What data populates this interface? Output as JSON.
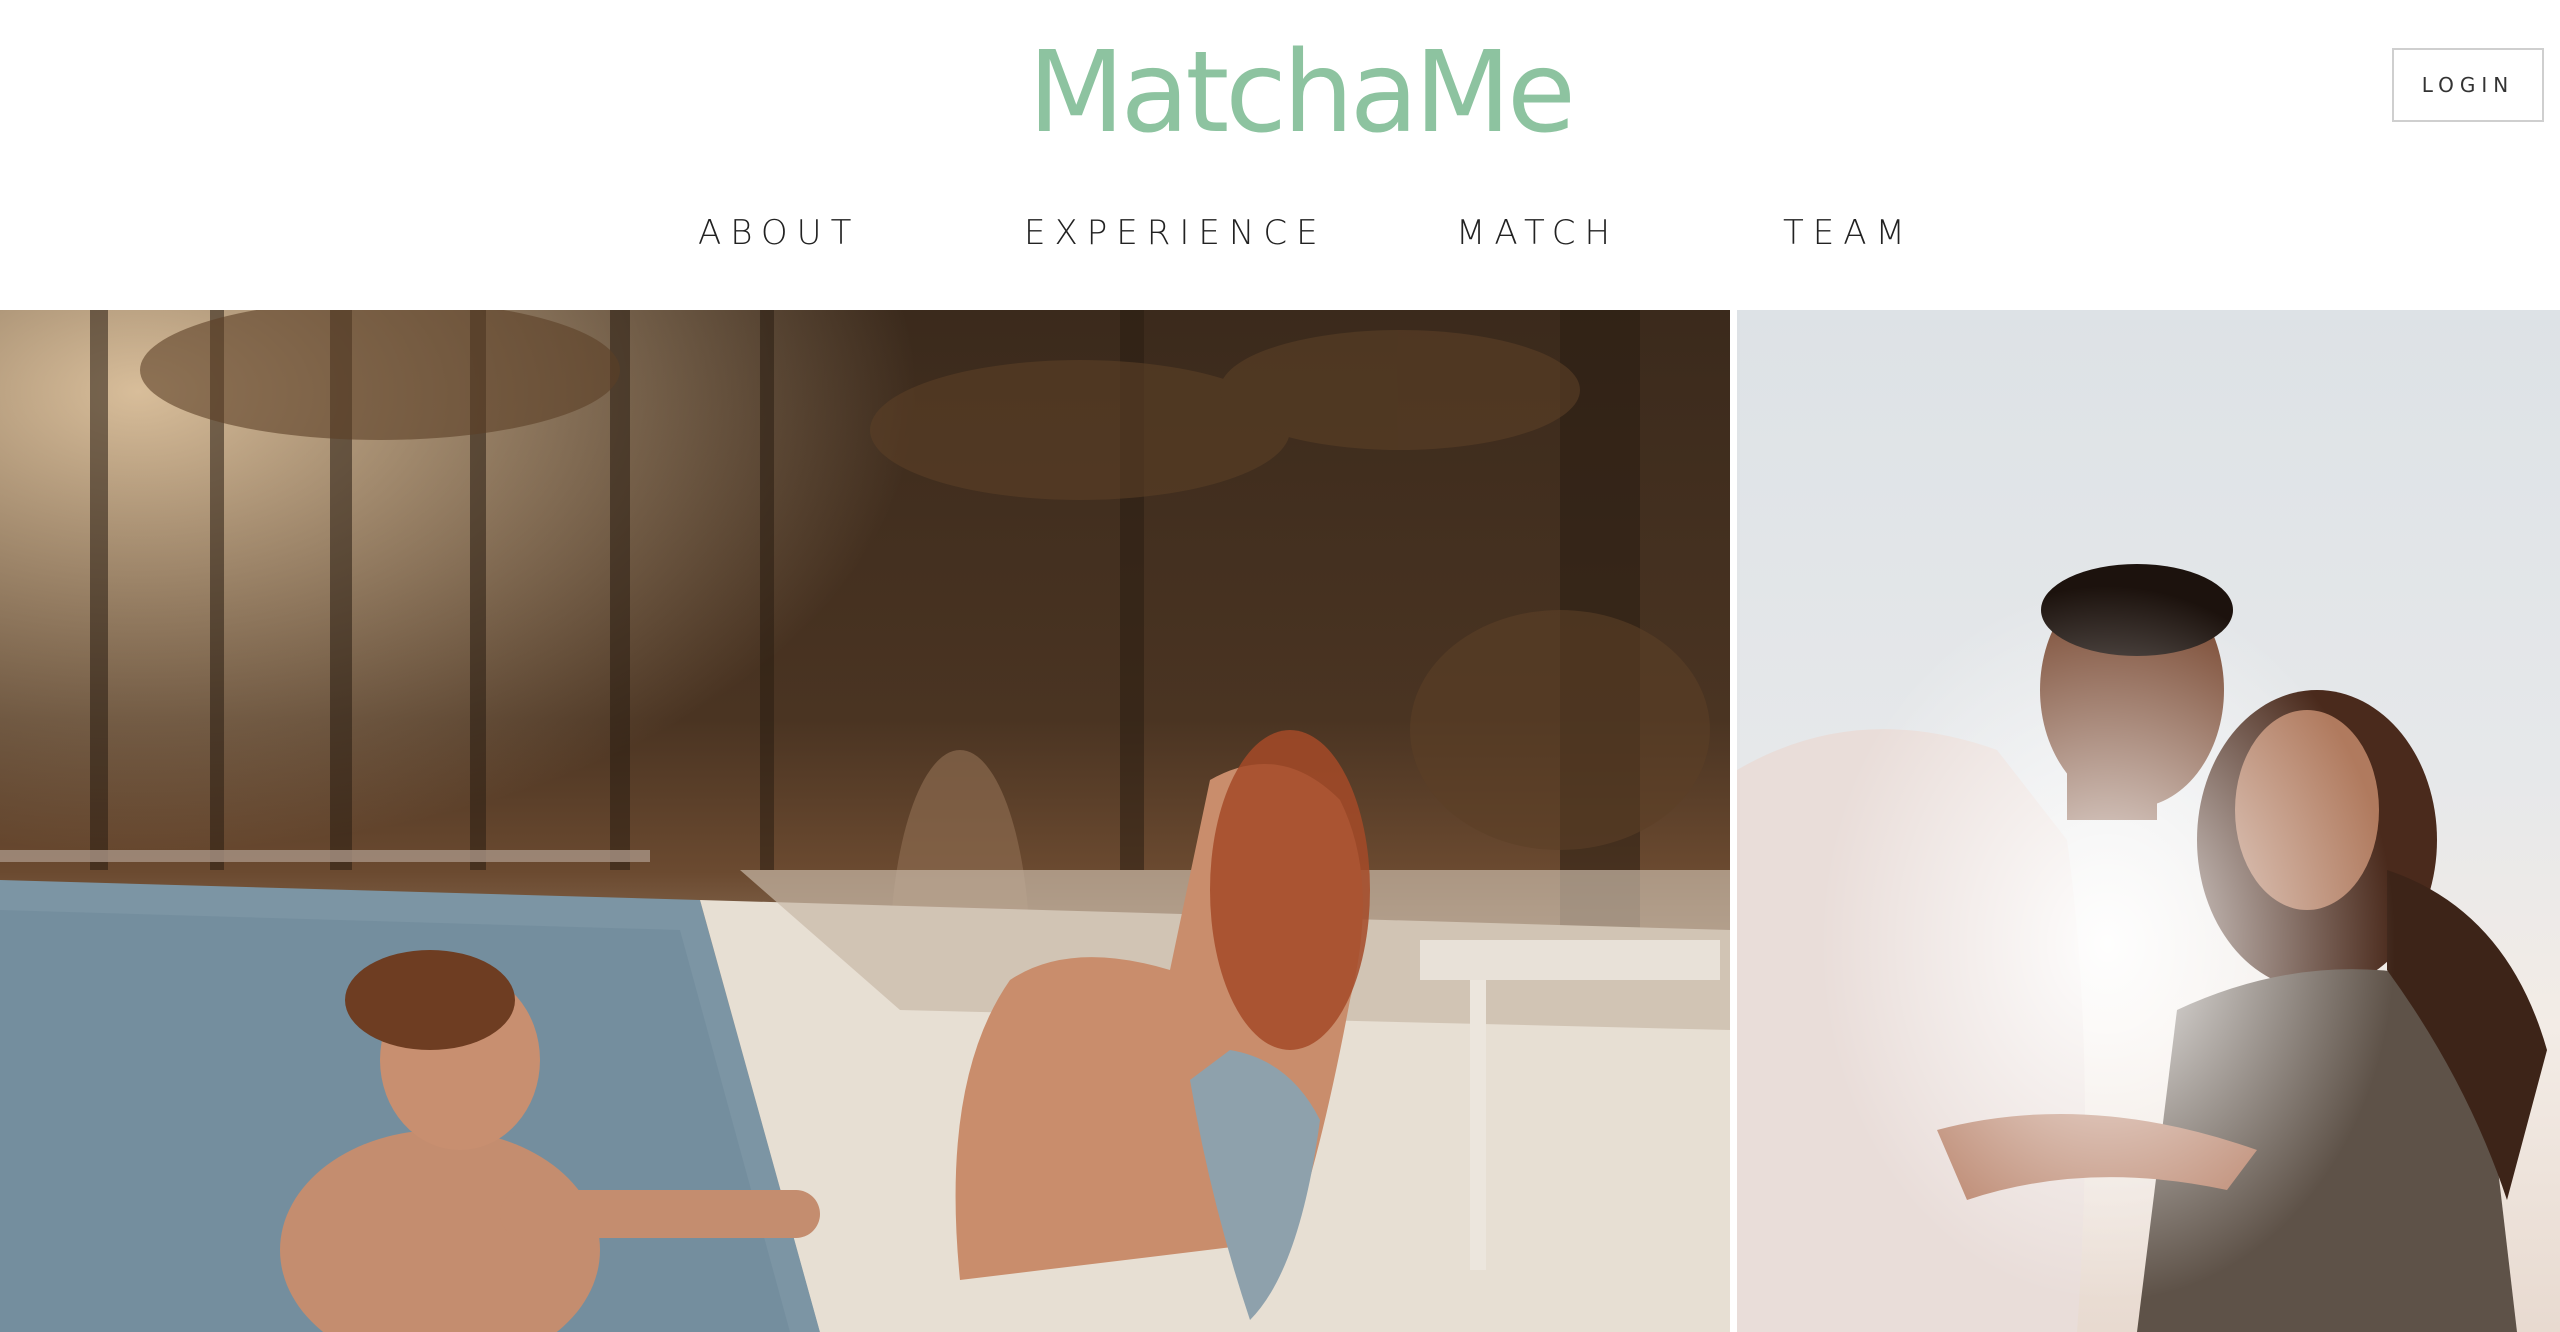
{
  "header": {
    "logo_text": "MatchaMe",
    "login_label": "LOGIN"
  },
  "nav": {
    "items": [
      {
        "label": "ABOUT"
      },
      {
        "label": "EXPERIENCE"
      },
      {
        "label": "MATCH"
      },
      {
        "label": "TEAM"
      }
    ]
  },
  "hero": {
    "photos": [
      {
        "subject": "poolside-couple-photo"
      },
      {
        "subject": "embracing-couple-photo"
      }
    ]
  },
  "colors": {
    "brand_green": "#8dc3a0",
    "nav_text": "#222222",
    "login_border": "#cfcfcf",
    "background": "#ffffff"
  }
}
